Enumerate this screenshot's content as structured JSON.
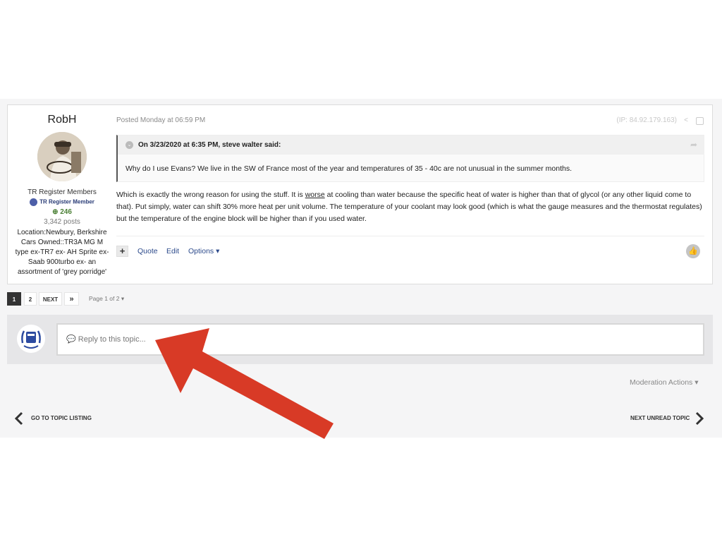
{
  "post": {
    "author": {
      "name": "RobH",
      "group": "TR Register Members",
      "badge": "TR Register Member",
      "reputation": "246",
      "posts": "3,342 posts",
      "location_line1": "Location:Newbury, Berkshire",
      "cars_line": "Cars Owned::TR3A MG M type ex-TR7 ex- AH Sprite ex-Saab 900turbo ex- an assortment of 'grey porridge'"
    },
    "date": "Posted Monday at 06:59 PM",
    "ip": "(IP: 84.92.179.163)",
    "quote": {
      "citation": "On 3/23/2020 at 6:35 PM, steve walter said:",
      "text": "Why do I use Evans? We live in the SW of France most of the year and temperatures of 35 - 40c are not unusual in the summer months."
    },
    "body_part1": "Which is exactly the wrong reason for using the stuff.   It is ",
    "body_underlined": "worse",
    "body_part2": " at cooling than water because the specific heat of water is higher than that of glycol (or any other liquid come to that). Put simply, water can shift 30% more heat per unit volume. The temperature of your coolant may look good (which is what the gauge measures and the thermostat regulates) but the temperature of the engine block will be higher than if you used water.",
    "actions": {
      "plus": "+",
      "quote": "Quote",
      "edit": "Edit",
      "options": "Options ▾"
    }
  },
  "pagination": {
    "pages": [
      "1",
      "2"
    ],
    "next": "NEXT",
    "last": "»",
    "page_of": "Page 1 of 2 ▾"
  },
  "reply": {
    "placeholder": "💬 Reply to this topic..."
  },
  "moderation": "Moderation Actions ▾",
  "nav": {
    "prev": "GO TO TOPIC LISTING",
    "next": "NEXT UNREAD TOPIC"
  },
  "colors": {
    "arrow": "#d83a26",
    "link": "#2c4a8b",
    "reputation": "#4a7f34"
  }
}
